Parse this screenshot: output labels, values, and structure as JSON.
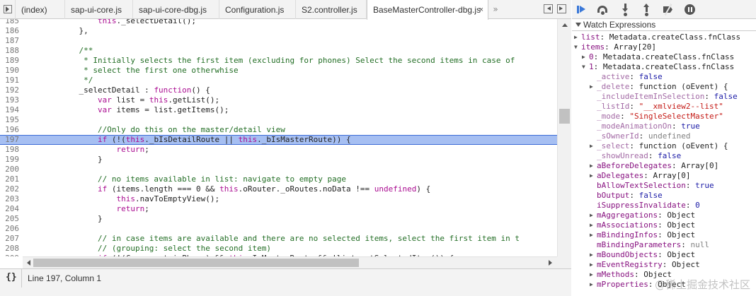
{
  "tabs": [
    {
      "label": "(index)"
    },
    {
      "label": "sap-ui-core.js"
    },
    {
      "label": "sap-ui-core-dbg.js"
    },
    {
      "label": "Configuration.js"
    },
    {
      "label": "S2.controller.js"
    },
    {
      "label": "BaseMasterController-dbg.js",
      "active": true,
      "close": "×"
    }
  ],
  "tab_overflow": "»",
  "code": {
    "highlighted_line": 197,
    "lines": [
      {
        "n": "185",
        "t": "                this._selectDetail();"
      },
      {
        "n": "186",
        "t": "            },"
      },
      {
        "n": "187",
        "t": ""
      },
      {
        "n": "188",
        "t": "            /**"
      },
      {
        "n": "189",
        "t": "             * Initially selects the first item (excluding for phones) Select the second items in case of"
      },
      {
        "n": "190",
        "t": "             * select the first one otherwhise"
      },
      {
        "n": "191",
        "t": "             */"
      },
      {
        "n": "192",
        "t": "            _selectDetail : function() {"
      },
      {
        "n": "193",
        "t": "                var list = this.getList();"
      },
      {
        "n": "194",
        "t": "                var items = list.getItems();"
      },
      {
        "n": "195",
        "t": ""
      },
      {
        "n": "196",
        "t": "                //Only do this on the master/detail view"
      },
      {
        "n": "197",
        "t": "                if (!(this._bIsDetailRoute || this._bIsMasterRoute)) {"
      },
      {
        "n": "198",
        "t": "                    return;"
      },
      {
        "n": "199",
        "t": "                }"
      },
      {
        "n": "200",
        "t": ""
      },
      {
        "n": "201",
        "t": "                // no items available in list: navigate to empty page"
      },
      {
        "n": "202",
        "t": "                if (items.length === 0 && this.oRouter._oRoutes.noData !== undefined) {"
      },
      {
        "n": "203",
        "t": "                    this.navToEmptyView();"
      },
      {
        "n": "204",
        "t": "                    return;"
      },
      {
        "n": "205",
        "t": "                }"
      },
      {
        "n": "206",
        "t": ""
      },
      {
        "n": "207",
        "t": "                // in case items are available and there are no selected items, select the first item in t"
      },
      {
        "n": "208",
        "t": "                // (grouping: select the second item)"
      },
      {
        "n": "209",
        "t": "                if (!(Component.isPhone) && this.IsMasterRoute && !list.getSelectedItem()) {"
      },
      {
        "n": "210",
        "t": ""
      }
    ]
  },
  "status": {
    "pretty_print": "{}",
    "cursor": "Line 197, Column 1"
  },
  "debugger": {
    "buttons": [
      "resume-icon",
      "step-over-icon",
      "step-into-icon",
      "step-out-icon",
      "deactivate-breakpoints-icon",
      "pause-on-exceptions-icon"
    ],
    "accent": "#3a78d8"
  },
  "watch": {
    "title": "Watch Expressions",
    "items": [
      {
        "indent": 0,
        "disc": "right",
        "name": "list",
        "sep": ": ",
        "value": "Metadata.createClass.fnClass",
        "vt": "obj"
      },
      {
        "indent": 0,
        "disc": "down",
        "name": "items",
        "sep": ": ",
        "value": "Array[20]",
        "vt": "obj"
      },
      {
        "indent": 1,
        "disc": "right",
        "name": "0",
        "sep": ": ",
        "value": "Metadata.createClass.fnClass",
        "vt": "obj"
      },
      {
        "indent": 1,
        "disc": "down",
        "name": "1",
        "sep": ": ",
        "value": "Metadata.createClass.fnClass",
        "vt": "obj"
      },
      {
        "indent": 2,
        "disc": "",
        "name": "_active",
        "sep": ": ",
        "value": "false",
        "vt": "kw"
      },
      {
        "indent": 2,
        "disc": "right",
        "name": "_delete",
        "sep": ": ",
        "value": "function (oEvent) {",
        "vt": "obj"
      },
      {
        "indent": 2,
        "disc": "",
        "name": "_includeItemInSelection",
        "sep": ": ",
        "value": "false",
        "vt": "kw"
      },
      {
        "indent": 2,
        "disc": "",
        "name": "_listId",
        "sep": ": ",
        "value": "\"__xmlview2--list\"",
        "vt": "str"
      },
      {
        "indent": 2,
        "disc": "",
        "name": "_mode",
        "sep": ": ",
        "value": "\"SingleSelectMaster\"",
        "vt": "str"
      },
      {
        "indent": 2,
        "disc": "",
        "name": "_modeAnimationOn",
        "sep": ": ",
        "value": "true",
        "vt": "kw"
      },
      {
        "indent": 2,
        "disc": "",
        "name": "_sOwnerId",
        "sep": ": ",
        "value": "undefined",
        "vt": "undef"
      },
      {
        "indent": 2,
        "disc": "right",
        "name": "_select",
        "sep": ": ",
        "value": "function (oEvent) {",
        "vt": "obj"
      },
      {
        "indent": 2,
        "disc": "",
        "name": "_showUnread",
        "sep": ": ",
        "value": "false",
        "vt": "kw"
      },
      {
        "indent": 2,
        "disc": "right",
        "name": "aBeforeDelegates",
        "sep": ": ",
        "value": "Array[0]",
        "vt": "obj"
      },
      {
        "indent": 2,
        "disc": "right",
        "name": "aDelegates",
        "sep": ": ",
        "value": "Array[0]",
        "vt": "obj"
      },
      {
        "indent": 2,
        "disc": "",
        "name": "bAllowTextSelection",
        "sep": ": ",
        "value": "true",
        "vt": "kw"
      },
      {
        "indent": 2,
        "disc": "",
        "name": "bOutput",
        "sep": ": ",
        "value": "false",
        "vt": "kw"
      },
      {
        "indent": 2,
        "disc": "",
        "name": "iSuppressInvalidate",
        "sep": ": ",
        "value": "0",
        "vt": "kw"
      },
      {
        "indent": 2,
        "disc": "right",
        "name": "mAggregations",
        "sep": ": ",
        "value": "Object",
        "vt": "obj"
      },
      {
        "indent": 2,
        "disc": "right",
        "name": "mAssociations",
        "sep": ": ",
        "value": "Object",
        "vt": "obj"
      },
      {
        "indent": 2,
        "disc": "right",
        "name": "mBindingInfos",
        "sep": ": ",
        "value": "Object",
        "vt": "obj"
      },
      {
        "indent": 2,
        "disc": "",
        "name": "mBindingParameters",
        "sep": ": ",
        "value": "null",
        "vt": "undef"
      },
      {
        "indent": 2,
        "disc": "right",
        "name": "mBoundObjects",
        "sep": ": ",
        "value": "Object",
        "vt": "obj"
      },
      {
        "indent": 2,
        "disc": "right",
        "name": "mEventRegistry",
        "sep": ": ",
        "value": "Object",
        "vt": "obj"
      },
      {
        "indent": 2,
        "disc": "right",
        "name": "mMethods",
        "sep": ": ",
        "value": "Object",
        "vt": "obj"
      },
      {
        "indent": 2,
        "disc": "right",
        "name": "mProperties",
        "sep": ": ",
        "value": "Object",
        "vt": "obj"
      }
    ]
  },
  "watermark": "@稀土掘金技术社区"
}
